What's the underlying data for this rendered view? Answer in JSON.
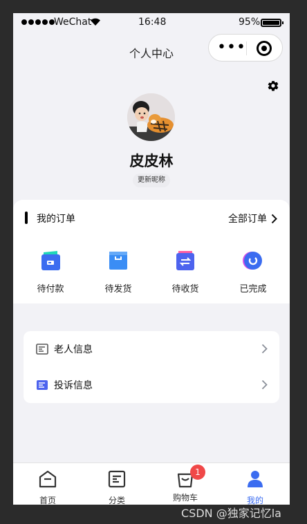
{
  "status_bar": {
    "carrier": "WeChat",
    "time": "16:48",
    "battery": "95%",
    "signal_dots": 5
  },
  "navigation": {
    "title": "个人中心"
  },
  "profile": {
    "name": "皮皮林",
    "update_nickname": "更新昵称"
  },
  "orders": {
    "title": "我的订单",
    "view_all": "全部订单",
    "items": [
      {
        "label": "待付款",
        "icon": "wallet-icon"
      },
      {
        "label": "待发货",
        "icon": "package-icon"
      },
      {
        "label": "待收货",
        "icon": "exchange-icon"
      },
      {
        "label": "已完成",
        "icon": "done-icon"
      }
    ]
  },
  "info_list": [
    {
      "label": "老人信息",
      "icon": "document-icon"
    },
    {
      "label": "投诉信息",
      "icon": "complaint-icon"
    }
  ],
  "tabbar": {
    "items": [
      {
        "label": "首页",
        "icon": "home-icon"
      },
      {
        "label": "分类",
        "icon": "category-icon"
      },
      {
        "label": "购物车",
        "icon": "cart-icon",
        "badge": "1"
      },
      {
        "label": "我的",
        "icon": "user-icon",
        "active": true
      }
    ]
  },
  "colors": {
    "accent": "#3b6cf0",
    "badge": "#f04848",
    "background": "#f2f2f6"
  },
  "watermark": "CSDN @独家记忆la"
}
